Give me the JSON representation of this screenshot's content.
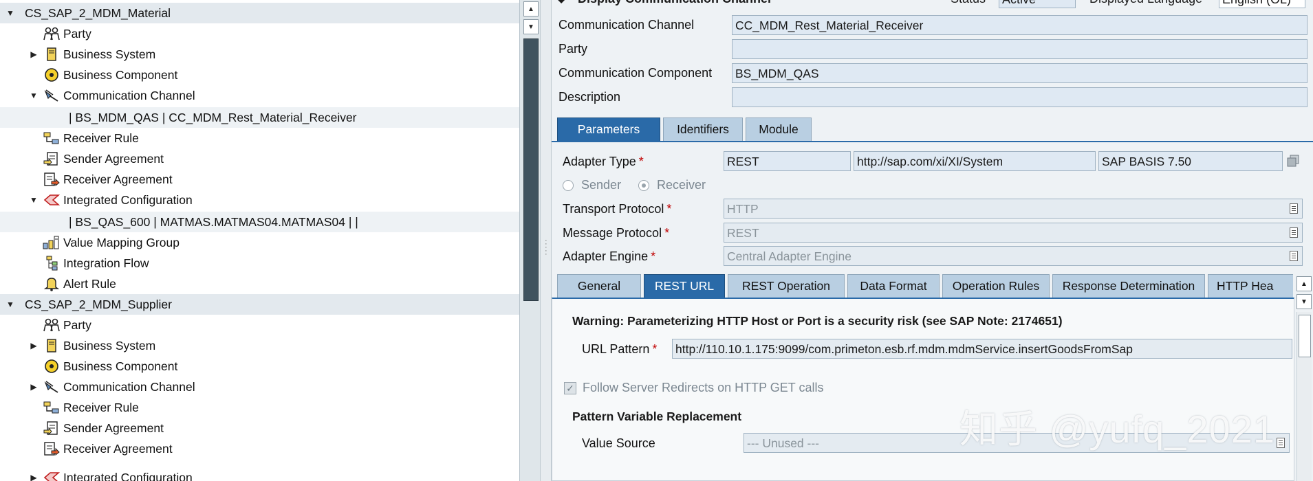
{
  "tree": {
    "groups": [
      {
        "label": "CS_SAP_2_MDM_Material",
        "items": [
          {
            "label": "Party",
            "icon": "party-icon",
            "expander": ""
          },
          {
            "label": "Business System",
            "icon": "business-system-icon",
            "expander": "▶"
          },
          {
            "label": "Business Component",
            "icon": "business-component-icon",
            "expander": ""
          },
          {
            "label": "Communication Channel",
            "icon": "communication-channel-icon",
            "expander": "▼"
          },
          {
            "label": "| BS_MDM_QAS | CC_MDM_Rest_Material_Receiver",
            "icon": "",
            "expander": ""
          },
          {
            "label": "Receiver Rule",
            "icon": "receiver-rule-icon",
            "expander": ""
          },
          {
            "label": "Sender Agreement",
            "icon": "sender-agreement-icon",
            "expander": ""
          },
          {
            "label": "Receiver Agreement",
            "icon": "receiver-agreement-icon",
            "expander": ""
          },
          {
            "label": "Integrated Configuration",
            "icon": "integrated-configuration-icon",
            "expander": "▼"
          },
          {
            "label": "| BS_QAS_600 | MATMAS.MATMAS04.MATMAS04 |  |",
            "icon": "",
            "expander": ""
          },
          {
            "label": "Value Mapping Group",
            "icon": "value-mapping-group-icon",
            "expander": ""
          },
          {
            "label": "Integration Flow",
            "icon": "integration-flow-icon",
            "expander": ""
          },
          {
            "label": "Alert Rule",
            "icon": "alert-rule-icon",
            "expander": ""
          }
        ]
      },
      {
        "label": "CS_SAP_2_MDM_Supplier",
        "items": [
          {
            "label": "Party",
            "icon": "party-icon",
            "expander": ""
          },
          {
            "label": "Business System",
            "icon": "business-system-icon",
            "expander": "▶"
          },
          {
            "label": "Business Component",
            "icon": "business-component-icon",
            "expander": ""
          },
          {
            "label": "Communication Channel",
            "icon": "communication-channel-icon",
            "expander": "▶"
          },
          {
            "label": "Receiver Rule",
            "icon": "receiver-rule-icon",
            "expander": ""
          },
          {
            "label": "Sender Agreement",
            "icon": "sender-agreement-icon",
            "expander": ""
          },
          {
            "label": "Receiver Agreement",
            "icon": "receiver-agreement-icon",
            "expander": ""
          },
          {
            "label": "Integrated Configuration",
            "icon": "integrated-configuration-icon",
            "expander": "▶"
          }
        ]
      }
    ]
  },
  "header": {
    "title": "Display Communication Channel",
    "status_label": "Status",
    "status_value": "Active",
    "language_label": "Displayed Language",
    "language_value": "English (OL)"
  },
  "fields": {
    "channel_label": "Communication Channel",
    "channel_value": "CC_MDM_Rest_Material_Receiver",
    "party_label": "Party",
    "party_value": "",
    "component_label": "Communication Component",
    "component_value": "BS_MDM_QAS",
    "description_label": "Description",
    "description_value": ""
  },
  "main_tabs": [
    "Parameters",
    "Identifiers",
    "Module"
  ],
  "params": {
    "adapter_type_label": "Adapter Type",
    "adapter_type": "REST",
    "adapter_namespace": "http://sap.com/xi/XI/System",
    "adapter_swcv": "SAP BASIS 7.50",
    "sender_label": "Sender",
    "receiver_label": "Receiver",
    "transport_label": "Transport Protocol",
    "transport_value": "HTTP",
    "message_label": "Message Protocol",
    "message_value": "REST",
    "engine_label": "Adapter Engine",
    "engine_value": "Central Adapter Engine",
    "required_mark": "*"
  },
  "sub_tabs": [
    "General",
    "REST URL",
    "REST Operation",
    "Data Format",
    "Operation Rules",
    "Response Determination",
    "HTTP Hea"
  ],
  "rest_url": {
    "warning": "Warning: Parameterizing HTTP Host or Port is a security risk (see SAP Note: 2174651)",
    "url_pattern_label": "URL Pattern",
    "url_pattern_value": "http://110.10.1.175:9099/com.primeton.esb.rf.mdm.mdmService.insertGoodsFromSap",
    "follow_redirects_label": "Follow Server Redirects on HTTP GET calls",
    "follow_redirects_checked": true,
    "pvr_heading": "Pattern Variable Replacement",
    "value_source_label": "Value Source",
    "value_source_value": "--- Unused ---"
  },
  "watermark": "知乎 @yufq_2021"
}
